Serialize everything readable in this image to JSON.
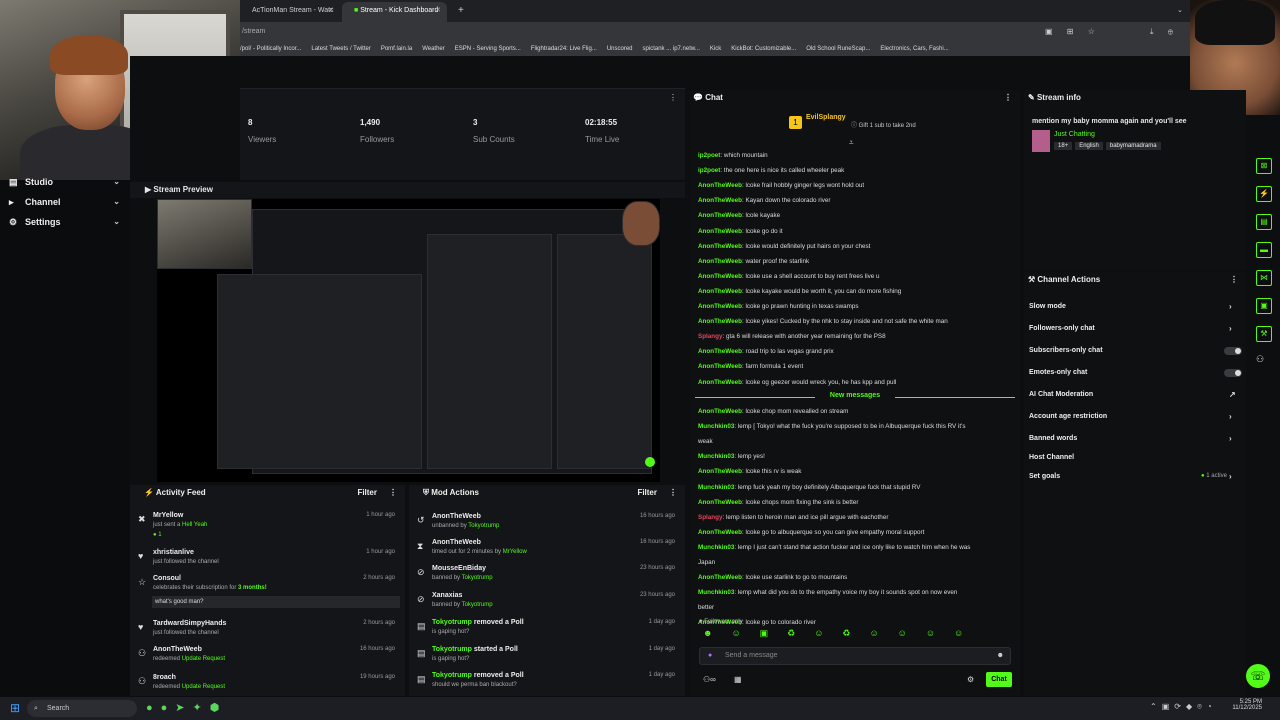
{
  "browser": {
    "tabs": [
      {
        "label": "AcTionMan Stream - Watc"
      },
      {
        "label": "Stream - Kick Dashboard"
      }
    ],
    "address": "/stream",
    "bookmarks": [
      "/pol/ - Politically Incor...",
      "Latest Tweets / Twitter",
      "Pomf.lain.la",
      "Weather",
      "ESPN - Serving Sports...",
      "Flightradar24: Live Flig...",
      "Unscored",
      "spictank ... ip7.netw...",
      "Kick",
      "KickBot: Customizable...",
      "Old School RuneScap...",
      "Electronics, Cars, Fashi..."
    ]
  },
  "nav": [
    {
      "label": "Studio",
      "icon": "studio-icon"
    },
    {
      "label": "Channel",
      "icon": "channel-icon"
    },
    {
      "label": "Settings",
      "icon": "gear-icon"
    }
  ],
  "stats": [
    {
      "value": "8",
      "label": "Viewers"
    },
    {
      "value": "1,490",
      "label": "Followers"
    },
    {
      "value": "3",
      "label": "Sub Counts"
    },
    {
      "value": "02:18:55",
      "label": "Time Live"
    }
  ],
  "preview": {
    "title": "Stream Preview"
  },
  "activity": {
    "title": "Activity Feed",
    "filter": "Filter",
    "items": [
      {
        "name": "MrYellow",
        "text1": "just sent a",
        "text2": "Hell Yeah",
        "time": "1 hour ago",
        "extra": "1"
      },
      {
        "name": "xhristianlive",
        "text1": "just followed the channel",
        "text2": "",
        "time": "1 hour ago"
      },
      {
        "name": "Consoul",
        "text1": "celebrates their subscription for",
        "text2": "3 months!",
        "time": "2 hours ago",
        "quote": "what's good man?"
      },
      {
        "name": "TardwardSimpyHands",
        "text1": "just followed the channel",
        "text2": "",
        "time": "2 hours ago"
      },
      {
        "name": "AnonTheWeeb",
        "text1": "redeemed",
        "text2": "Update Request",
        "time": "16 hours ago"
      },
      {
        "name": "8roach",
        "text1": "redeemed",
        "text2": "Update Request",
        "time": "19 hours ago"
      }
    ]
  },
  "mod": {
    "title": "Mod Actions",
    "filter": "Filter",
    "items": [
      {
        "name": "AnonTheWeeb",
        "text1": "unbanned by",
        "text2": "Tokyotrump",
        "time": "16 hours ago"
      },
      {
        "name": "AnonTheWeeb",
        "text1": "timed out for 2 minutes by",
        "text2": "MrYellow",
        "time": "16 hours ago"
      },
      {
        "name": "MousseEnBiday",
        "text1": "banned by",
        "text2": "Tokyotrump",
        "time": "23 hours ago"
      },
      {
        "name": "Xanaxias",
        "text1": "banned by",
        "text2": "Tokyotrump",
        "time": "23 hours ago"
      },
      {
        "name": "Tokyotrump",
        "action": "removed a Poll",
        "text1": "is gaping hot?",
        "text2": "",
        "time": "1 day ago"
      },
      {
        "name": "Tokyotrump",
        "action": "started a Poll",
        "text1": "is gaping hot?",
        "text2": "",
        "time": "1 day ago"
      },
      {
        "name": "Tokyotrump",
        "action": "removed a Poll",
        "text1": "should we perma ban blackout?",
        "text2": "",
        "time": "1 day ago"
      }
    ]
  },
  "chat": {
    "title": "Chat",
    "pinned_user": "EvilSplangy",
    "gift": "Gift 1 sub to take 2nd",
    "new_messages": "New messages",
    "followers_only": "Followers only",
    "placeholder": "Send a message",
    "send": "Chat",
    "before": [
      {
        "u": "ip2poet",
        "m": "which mountain"
      },
      {
        "u": "ip2poet",
        "m": "the one here is nice its called wheeler peak"
      },
      {
        "u": "AnonTheWeeb",
        "m": "lcoke frail hobbly ginger legs wont hold out"
      },
      {
        "u": "AnonTheWeeb",
        "m": "Kayan down the colorado river"
      },
      {
        "u": "AnonTheWeeb",
        "m": "lcole kayake"
      },
      {
        "u": "AnonTheWeeb",
        "m": "lcoke go do it"
      },
      {
        "u": "AnonTheWeeb",
        "m": "lcoke would definitely put hairs on your chest"
      },
      {
        "u": "AnonTheWeeb",
        "m": "water proof the starlink"
      },
      {
        "u": "AnonTheWeeb",
        "m": "lcoke use a shell account to buy rent frees live u"
      },
      {
        "u": "AnonTheWeeb",
        "m": "lcoke kayake would be worth it, you can do more fishing"
      },
      {
        "u": "AnonTheWeeb",
        "m": "lcoke go prawn hunting in texas swamps"
      },
      {
        "u": "AnonTheWeeb",
        "m": "lcoke yikes! Cucked by the nhk to stay inside and not safe the white man"
      },
      {
        "u": "Splangy",
        "m": "gta 6 will release with another year remaining for the PS8",
        "red": true
      },
      {
        "u": "AnonTheWeeb",
        "m": "road trip to las vegas grand prix"
      },
      {
        "u": "AnonTheWeeb",
        "m": "farm formula 1 event"
      },
      {
        "u": "AnonTheWeeb",
        "m": "lcoke og geezer would wreck you, he has kpp and pull"
      }
    ],
    "after": [
      {
        "u": "AnonTheWeeb",
        "m": "lcoke chop mom revealled on stream"
      },
      {
        "u": "Munchkin03",
        "m": "lemp [ Tokyo! what the fuck you're supposed to be in Albuquerque fuck this RV it's"
      },
      {
        "u": "",
        "m": "weak"
      },
      {
        "u": "Munchkin03",
        "m": "lemp yes!"
      },
      {
        "u": "AnonTheWeeb",
        "m": "lcoke this rv is weak"
      },
      {
        "u": "Munchkin03",
        "m": "lemp fuck yeah my boy definitely Albuquerque fuck that stupid RV"
      },
      {
        "u": "AnonTheWeeb",
        "m": "lcoke chops mom fixing the sink is better"
      },
      {
        "u": "Splangy",
        "m": "lemp listen to heroin man and ice pill argue with eachother",
        "red": true
      },
      {
        "u": "AnonTheWeeb",
        "m": "lcoke go to albuquerque so you can give empathy moral support"
      },
      {
        "u": "Munchkin03",
        "m": "lemp I just can't stand that action fucker and ice only like to watch him when he was"
      },
      {
        "u": "",
        "m": "Japan"
      },
      {
        "u": "AnonTheWeeb",
        "m": "lcoke use starlink to go to mountains"
      },
      {
        "u": "Munchkin03",
        "m": "lemp what did you do to the empathy voice my boy it sounds spot on now even"
      },
      {
        "u": "",
        "m": "better"
      },
      {
        "u": "AnonTheWeeb",
        "m": "lcoke go to colorado river"
      }
    ]
  },
  "info": {
    "title": "Stream info",
    "stream_title": "mention my baby momma again and you'll see",
    "category": "Just Chatting",
    "tags": [
      "18+",
      "English",
      "babymamadrama"
    ]
  },
  "actions": {
    "title": "Channel Actions",
    "items": [
      {
        "label": "Slow mode",
        "ctrl": "chev"
      },
      {
        "label": "Followers-only chat",
        "ctrl": "chev"
      },
      {
        "label": "Subscribers-only chat",
        "ctrl": "toggle"
      },
      {
        "label": "Emotes-only chat",
        "ctrl": "toggle"
      },
      {
        "label": "AI Chat Moderation",
        "ctrl": "ext"
      },
      {
        "label": "Account age restriction",
        "ctrl": "chev"
      },
      {
        "label": "Banned words",
        "ctrl": "chev"
      },
      {
        "label": "Host Channel",
        "ctrl": "none"
      },
      {
        "label": "Set goals",
        "ctrl": "chev",
        "badge": "1 active"
      }
    ]
  },
  "taskbar": {
    "search": "Search",
    "time": "5:25 PM",
    "date": "11/12/2025"
  },
  "colors": {
    "accent": "#53fc18",
    "danger": "#e0455f"
  }
}
